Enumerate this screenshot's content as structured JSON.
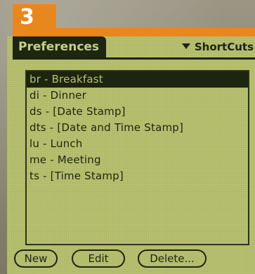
{
  "step": {
    "number": "3"
  },
  "title_bar": {
    "title": "Preferences",
    "category": "ShortCuts"
  },
  "shortcuts": [
    {
      "label": "br - Breakfast",
      "selected": true
    },
    {
      "label": "di - Dinner",
      "selected": false
    },
    {
      "label": "ds - [Date Stamp]",
      "selected": false
    },
    {
      "label": "dts - [Date and Time Stamp]",
      "selected": false
    },
    {
      "label": "lu - Lunch",
      "selected": false
    },
    {
      "label": "me - Meeting",
      "selected": false
    },
    {
      "label": "ts - [Time Stamp]",
      "selected": false
    }
  ],
  "buttons": {
    "new": "New",
    "edit": "Edit",
    "delete": "Delete..."
  },
  "colors": {
    "lcd_background": "#b8c16f",
    "lcd_ink": "#1d2410",
    "badge_orange": "#e8871e"
  }
}
